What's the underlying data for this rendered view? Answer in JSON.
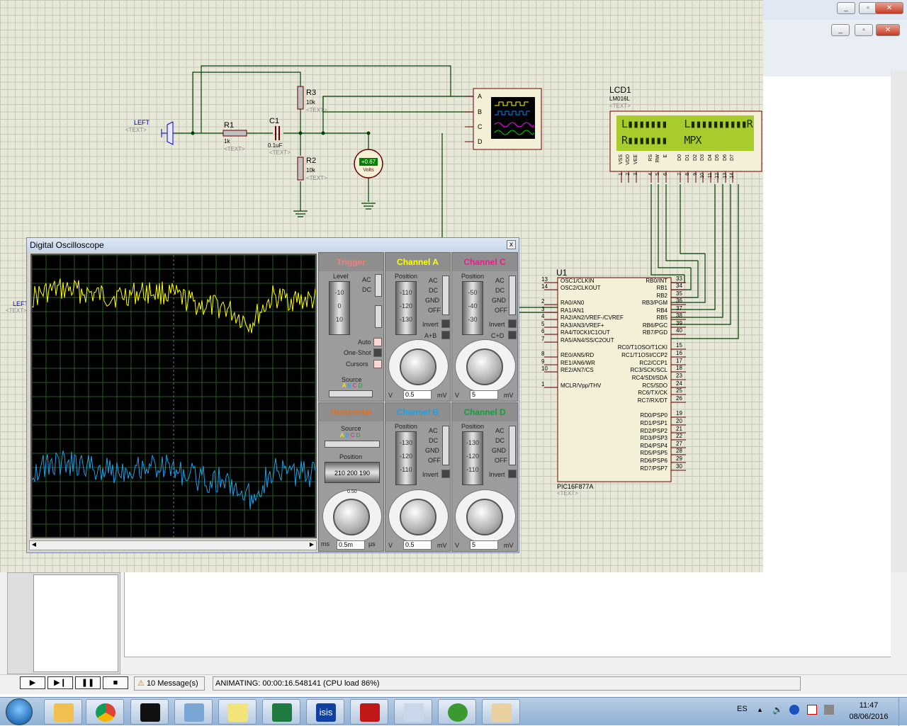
{
  "schematic": {
    "components": {
      "left_label": "LEFT",
      "text_placeholder": "<TEXT>",
      "r1": {
        "name": "R1",
        "value": "1k"
      },
      "c1": {
        "name": "C1",
        "value": "0.1uF"
      },
      "r3": {
        "name": "R3",
        "value": "10k"
      },
      "r2": {
        "name": "R2",
        "value": "10k"
      },
      "voltmeter": {
        "reading": "+0.67",
        "unit": "Volts"
      },
      "scope_inputs": [
        "A",
        "B",
        "C",
        "D"
      ]
    },
    "lcd": {
      "name": "LCD1",
      "model": "LM016L",
      "line1": "L▮▮▮▮▮▮▮   L▮▮▮▮▮▮▮▮▮▮R",
      "line2": "R▮▮▮▮▮▮▮   MPX",
      "pin_labels": [
        "VSS",
        "VDD",
        "VEE",
        "RS",
        "RW",
        "E",
        "D0",
        "D1",
        "D2",
        "D3",
        "D4",
        "D5",
        "D6",
        "D7"
      ],
      "pin_numbers": [
        "1",
        "2",
        "3",
        "4",
        "5",
        "6",
        "7",
        "8",
        "9",
        "10",
        "11",
        "12",
        "13",
        "14"
      ]
    },
    "mcu": {
      "name": "U1",
      "model": "PIC16F877A",
      "left_pins": [
        {
          "num": "13",
          "label": "OSC1/CLKIN"
        },
        {
          "num": "14",
          "label": "OSC2/CLKOUT"
        },
        {
          "num": "2",
          "label": "RA0/AN0"
        },
        {
          "num": "3",
          "label": "RA1/AN1"
        },
        {
          "num": "4",
          "label": "RA2/AN2/VREF-/CVREF"
        },
        {
          "num": "5",
          "label": "RA3/AN3/VREF+"
        },
        {
          "num": "6",
          "label": "RA4/T0CKI/C1OUT"
        },
        {
          "num": "7",
          "label": "RA5/AN4/SS/C2OUT"
        },
        {
          "num": "8",
          "label": "RE0/AN5/RD"
        },
        {
          "num": "9",
          "label": "RE1/AN6/WR"
        },
        {
          "num": "10",
          "label": "RE2/AN7/CS"
        },
        {
          "num": "1",
          "label": "MCLR/Vpp/THV"
        }
      ],
      "right_pins": [
        {
          "num": "33",
          "label": "RB0/INT"
        },
        {
          "num": "34",
          "label": "RB1"
        },
        {
          "num": "35",
          "label": "RB2"
        },
        {
          "num": "36",
          "label": "RB3/PGM"
        },
        {
          "num": "37",
          "label": "RB4"
        },
        {
          "num": "38",
          "label": "RB5"
        },
        {
          "num": "39",
          "label": "RB6/PGC"
        },
        {
          "num": "40",
          "label": "RB7/PGD"
        },
        {
          "num": "15",
          "label": "RC0/T1OSO/T1CKI"
        },
        {
          "num": "16",
          "label": "RC1/T1OSI/CCP2"
        },
        {
          "num": "17",
          "label": "RC2/CCP1"
        },
        {
          "num": "18",
          "label": "RC3/SCK/SCL"
        },
        {
          "num": "23",
          "label": "RC4/SDI/SDA"
        },
        {
          "num": "24",
          "label": "RC5/SDO"
        },
        {
          "num": "25",
          "label": "RC6/TX/CK"
        },
        {
          "num": "26",
          "label": "RC7/RX/DT"
        },
        {
          "num": "19",
          "label": "RD0/PSP0"
        },
        {
          "num": "20",
          "label": "RD1/PSP1"
        },
        {
          "num": "21",
          "label": "RD2/PSP2"
        },
        {
          "num": "22",
          "label": "RD3/PSP3"
        },
        {
          "num": "27",
          "label": "RD4/PSP4"
        },
        {
          "num": "28",
          "label": "RD5/PSP5"
        },
        {
          "num": "29",
          "label": "RD6/PSP6"
        },
        {
          "num": "30",
          "label": "RD7/PSP7"
        }
      ]
    }
  },
  "oscilloscope": {
    "title": "Digital Oscilloscope",
    "close": "x",
    "trigger": {
      "title": "Trigger",
      "level": "Level",
      "ticks": [
        "-10",
        "0",
        "10"
      ],
      "modes": [
        "AC",
        "DC"
      ],
      "auto": "Auto",
      "one_shot": "One-Shot",
      "cursors": "Cursors",
      "source": "Source",
      "sources": [
        "A",
        "B",
        "C",
        "D"
      ]
    },
    "channel_a": {
      "title": "Channel A",
      "position": "Position",
      "ticks": [
        "-110",
        "-120",
        "-130"
      ],
      "coupling": [
        "AC",
        "DC",
        "GND",
        "OFF"
      ],
      "invert": "Invert",
      "math": "A+B",
      "value": "0.5",
      "units": [
        "V",
        "mV"
      ],
      "scale": [
        "0.2",
        "0.1",
        "50",
        "20",
        "10",
        "5",
        "2",
        "1",
        "0.5",
        "20",
        "5",
        "2"
      ]
    },
    "channel_c": {
      "title": "Channel C",
      "position": "Position",
      "ticks": [
        "-50",
        "-40",
        "-30"
      ],
      "coupling": [
        "AC",
        "DC",
        "GND",
        "OFF"
      ],
      "invert": "Invert",
      "math": "C+D",
      "value": "5",
      "units": [
        "V",
        "mV"
      ]
    },
    "horizontal": {
      "title": "Horizontal",
      "source": "Source",
      "sources": [
        "A",
        "B",
        "C",
        "D"
      ],
      "position": "Position",
      "ticks": [
        "210",
        "200",
        "190"
      ],
      "value": "0.5m",
      "units": [
        "ms",
        "µs"
      ],
      "scale": [
        "0.50",
        "0.2",
        "1",
        "0.1",
        "2",
        "50",
        "5",
        "20",
        "10",
        "10",
        "20",
        "5",
        "50",
        "2",
        "100",
        "1",
        "200",
        "0.5"
      ]
    },
    "channel_b": {
      "title": "Channel B",
      "position": "Position",
      "ticks": [
        "-130",
        "-120",
        "-110"
      ],
      "coupling": [
        "AC",
        "DC",
        "GND",
        "OFF"
      ],
      "invert": "Invert",
      "value": "0.5",
      "units": [
        "V",
        "mV"
      ]
    },
    "channel_d": {
      "title": "Channel D",
      "position": "Position",
      "ticks": [
        "-130",
        "-120",
        "-110"
      ],
      "coupling": [
        "AC",
        "DC",
        "GND",
        "OFF"
      ],
      "invert": "Invert",
      "value": "5",
      "units": [
        "V",
        "mV"
      ]
    },
    "colors": {
      "a": "#ffff00",
      "b": "#1ea0e6",
      "c": "#e0218a",
      "d": "#1a9a3a",
      "trigger": "#f08080",
      "horizontal": "#e07020"
    }
  },
  "status": {
    "messages": "10 Message(s)",
    "animating": "ANIMATING: 00:00:16.548141 (CPU load 86%)"
  },
  "tray": {
    "lang": "ES",
    "time": "11:47",
    "date": "08/06/2016"
  },
  "taskbar_icons": [
    "start-orb-icon",
    "file-explorer-icon",
    "chrome-icon",
    "cmd-icon",
    "control-panel-icon",
    "sticky-notes-icon",
    "excel-icon",
    "isis-icon",
    "mcafee-icon",
    "calculator-icon",
    "download-manager-icon",
    "paint-icon"
  ],
  "isis_label": "isis"
}
